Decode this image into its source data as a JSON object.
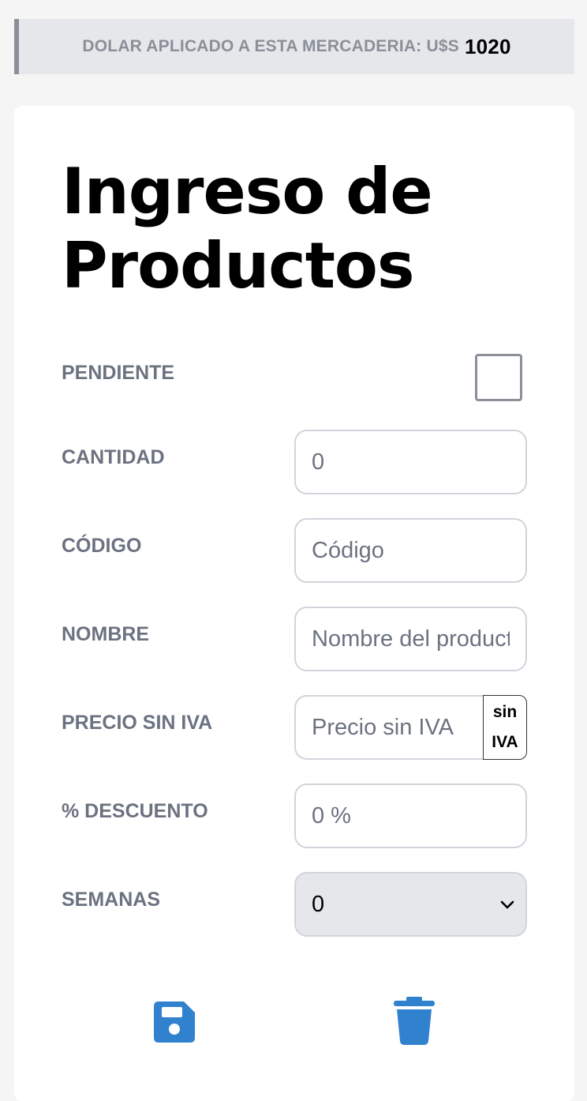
{
  "banner": {
    "label": "DOLAR APLICADO A ESTA MERCADERIA: U$S",
    "amount": "1020"
  },
  "form": {
    "title": "Ingreso de Productos",
    "pendiente": {
      "label": "PENDIENTE",
      "checked": false
    },
    "cantidad": {
      "label": "CANTIDAD",
      "placeholder": "0"
    },
    "codigo": {
      "label": "CÓDIGO",
      "placeholder": "Código"
    },
    "nombre": {
      "label": "NOMBRE",
      "placeholder": "Nombre del producto"
    },
    "precio": {
      "label": "PRECIO SIN IVA",
      "placeholder": "Precio sin IVA",
      "suffix": "sin IVA"
    },
    "descuento": {
      "label": "% DESCUENTO",
      "placeholder": "0 %"
    },
    "semanas": {
      "label": "SEMANAS",
      "value": "0"
    }
  },
  "actions": {
    "save_icon": "floppy-disk-icon",
    "delete_icon": "trash-icon",
    "icon_color": "#3182ce"
  }
}
